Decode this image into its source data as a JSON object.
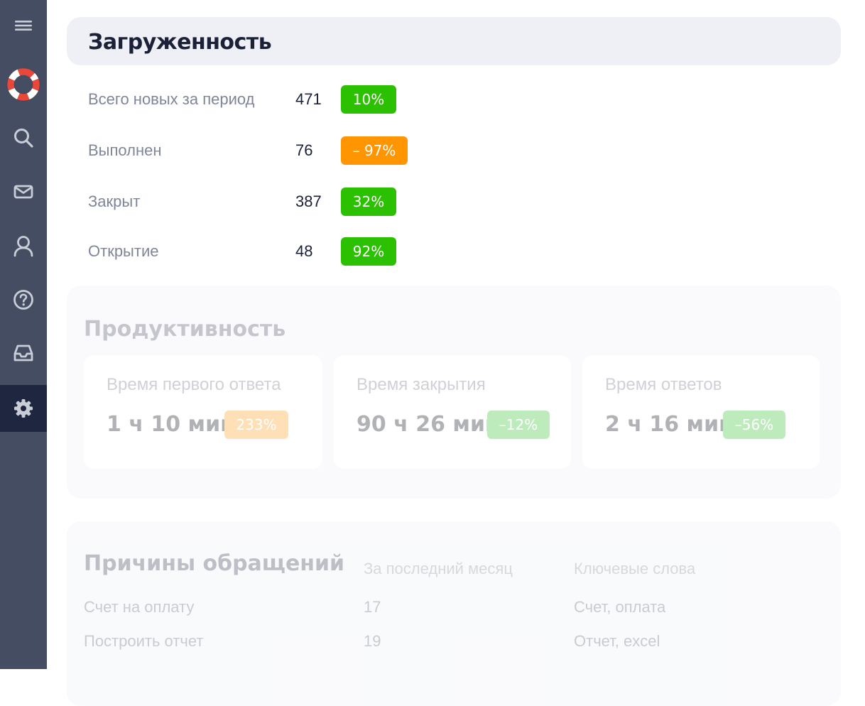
{
  "sidebar": {
    "items": [
      {
        "icon": "menu-icon"
      },
      {
        "icon": "lifebuoy-icon"
      },
      {
        "icon": "search-icon"
      },
      {
        "icon": "mail-icon"
      },
      {
        "icon": "user-icon"
      },
      {
        "icon": "help-icon"
      },
      {
        "icon": "inbox-icon"
      },
      {
        "icon": "gear-icon",
        "active": true
      }
    ]
  },
  "load": {
    "title": "Загруженность",
    "rows": [
      {
        "label": "Всего новых за период",
        "value": "471",
        "badge": "10%",
        "badge_color": "#2cc100"
      },
      {
        "label": "Выполнен",
        "value": "76",
        "badge": "– 97%",
        "badge_color": "#ff9500"
      },
      {
        "label": "Закрыт",
        "value": "387",
        "badge": "32%",
        "badge_color": "#2cc100"
      },
      {
        "label": "Открытие",
        "value": "48",
        "badge": "92%",
        "badge_color": "#2cc100"
      }
    ]
  },
  "productivity": {
    "title": "Продуктивность",
    "metrics": [
      {
        "label": "Время первого ответа",
        "value": "1 ч 10 мин",
        "badge": "233%",
        "badge_color": "#ffb24a"
      },
      {
        "label": "Время закрытия",
        "value": "90 ч 26 мин",
        "badge": "–12%",
        "badge_color": "#5fcf5a"
      },
      {
        "label": "Время ответов",
        "value": "2 ч 16 мин",
        "badge": "–56%",
        "badge_color": "#5fcf5a"
      }
    ]
  },
  "reasons": {
    "title": "Причины обращений",
    "col_period": "За последний месяц",
    "col_keywords": "Ключевые слова",
    "rows": [
      {
        "reason": "Счет на оплату",
        "count": "17",
        "keywords": "Счет, оплата"
      },
      {
        "reason": "Построить отчет",
        "count": "19",
        "keywords": "Отчет, excel"
      }
    ]
  },
  "colors": {
    "sidebar_bg": "#454d62",
    "sidebar_active": "#1f2740",
    "badge_green": "#2cc100",
    "badge_orange": "#ff9500"
  }
}
